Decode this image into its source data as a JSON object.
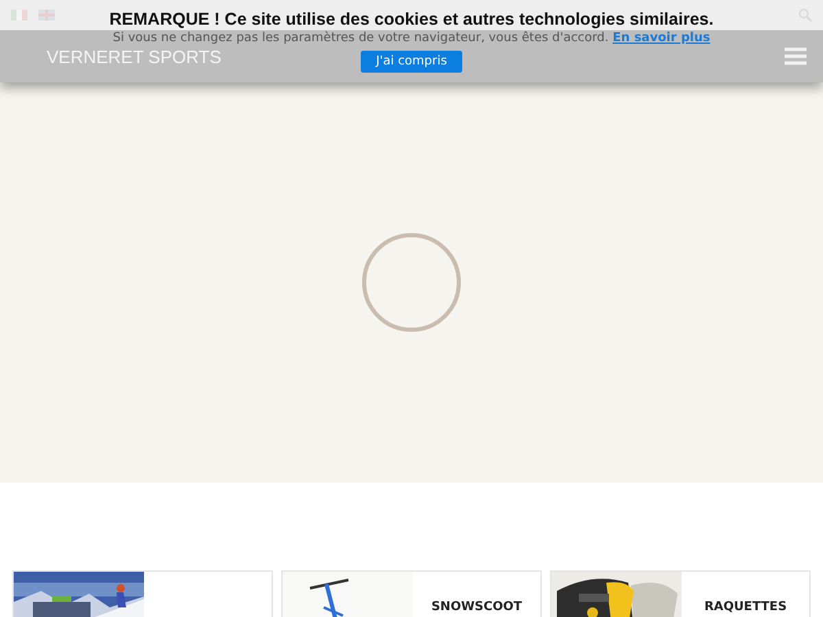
{
  "header": {
    "logo": "VERNERET SPORTS"
  },
  "cookie_banner": {
    "title": "REMARQUE ! Ce site utilise des cookies et autres technologies similaires.",
    "message": "Si vous ne changez pas les paramètres de votre navigateur, vous êtes d'accord.",
    "link": "En savoir plus",
    "button": "J'ai compris"
  },
  "products": [
    {
      "kind": "picture"
    },
    {
      "kind": "picture",
      "label": "SNOWSCOOT"
    },
    {
      "kind": "picture",
      "label": "RAQUETTES"
    }
  ]
}
